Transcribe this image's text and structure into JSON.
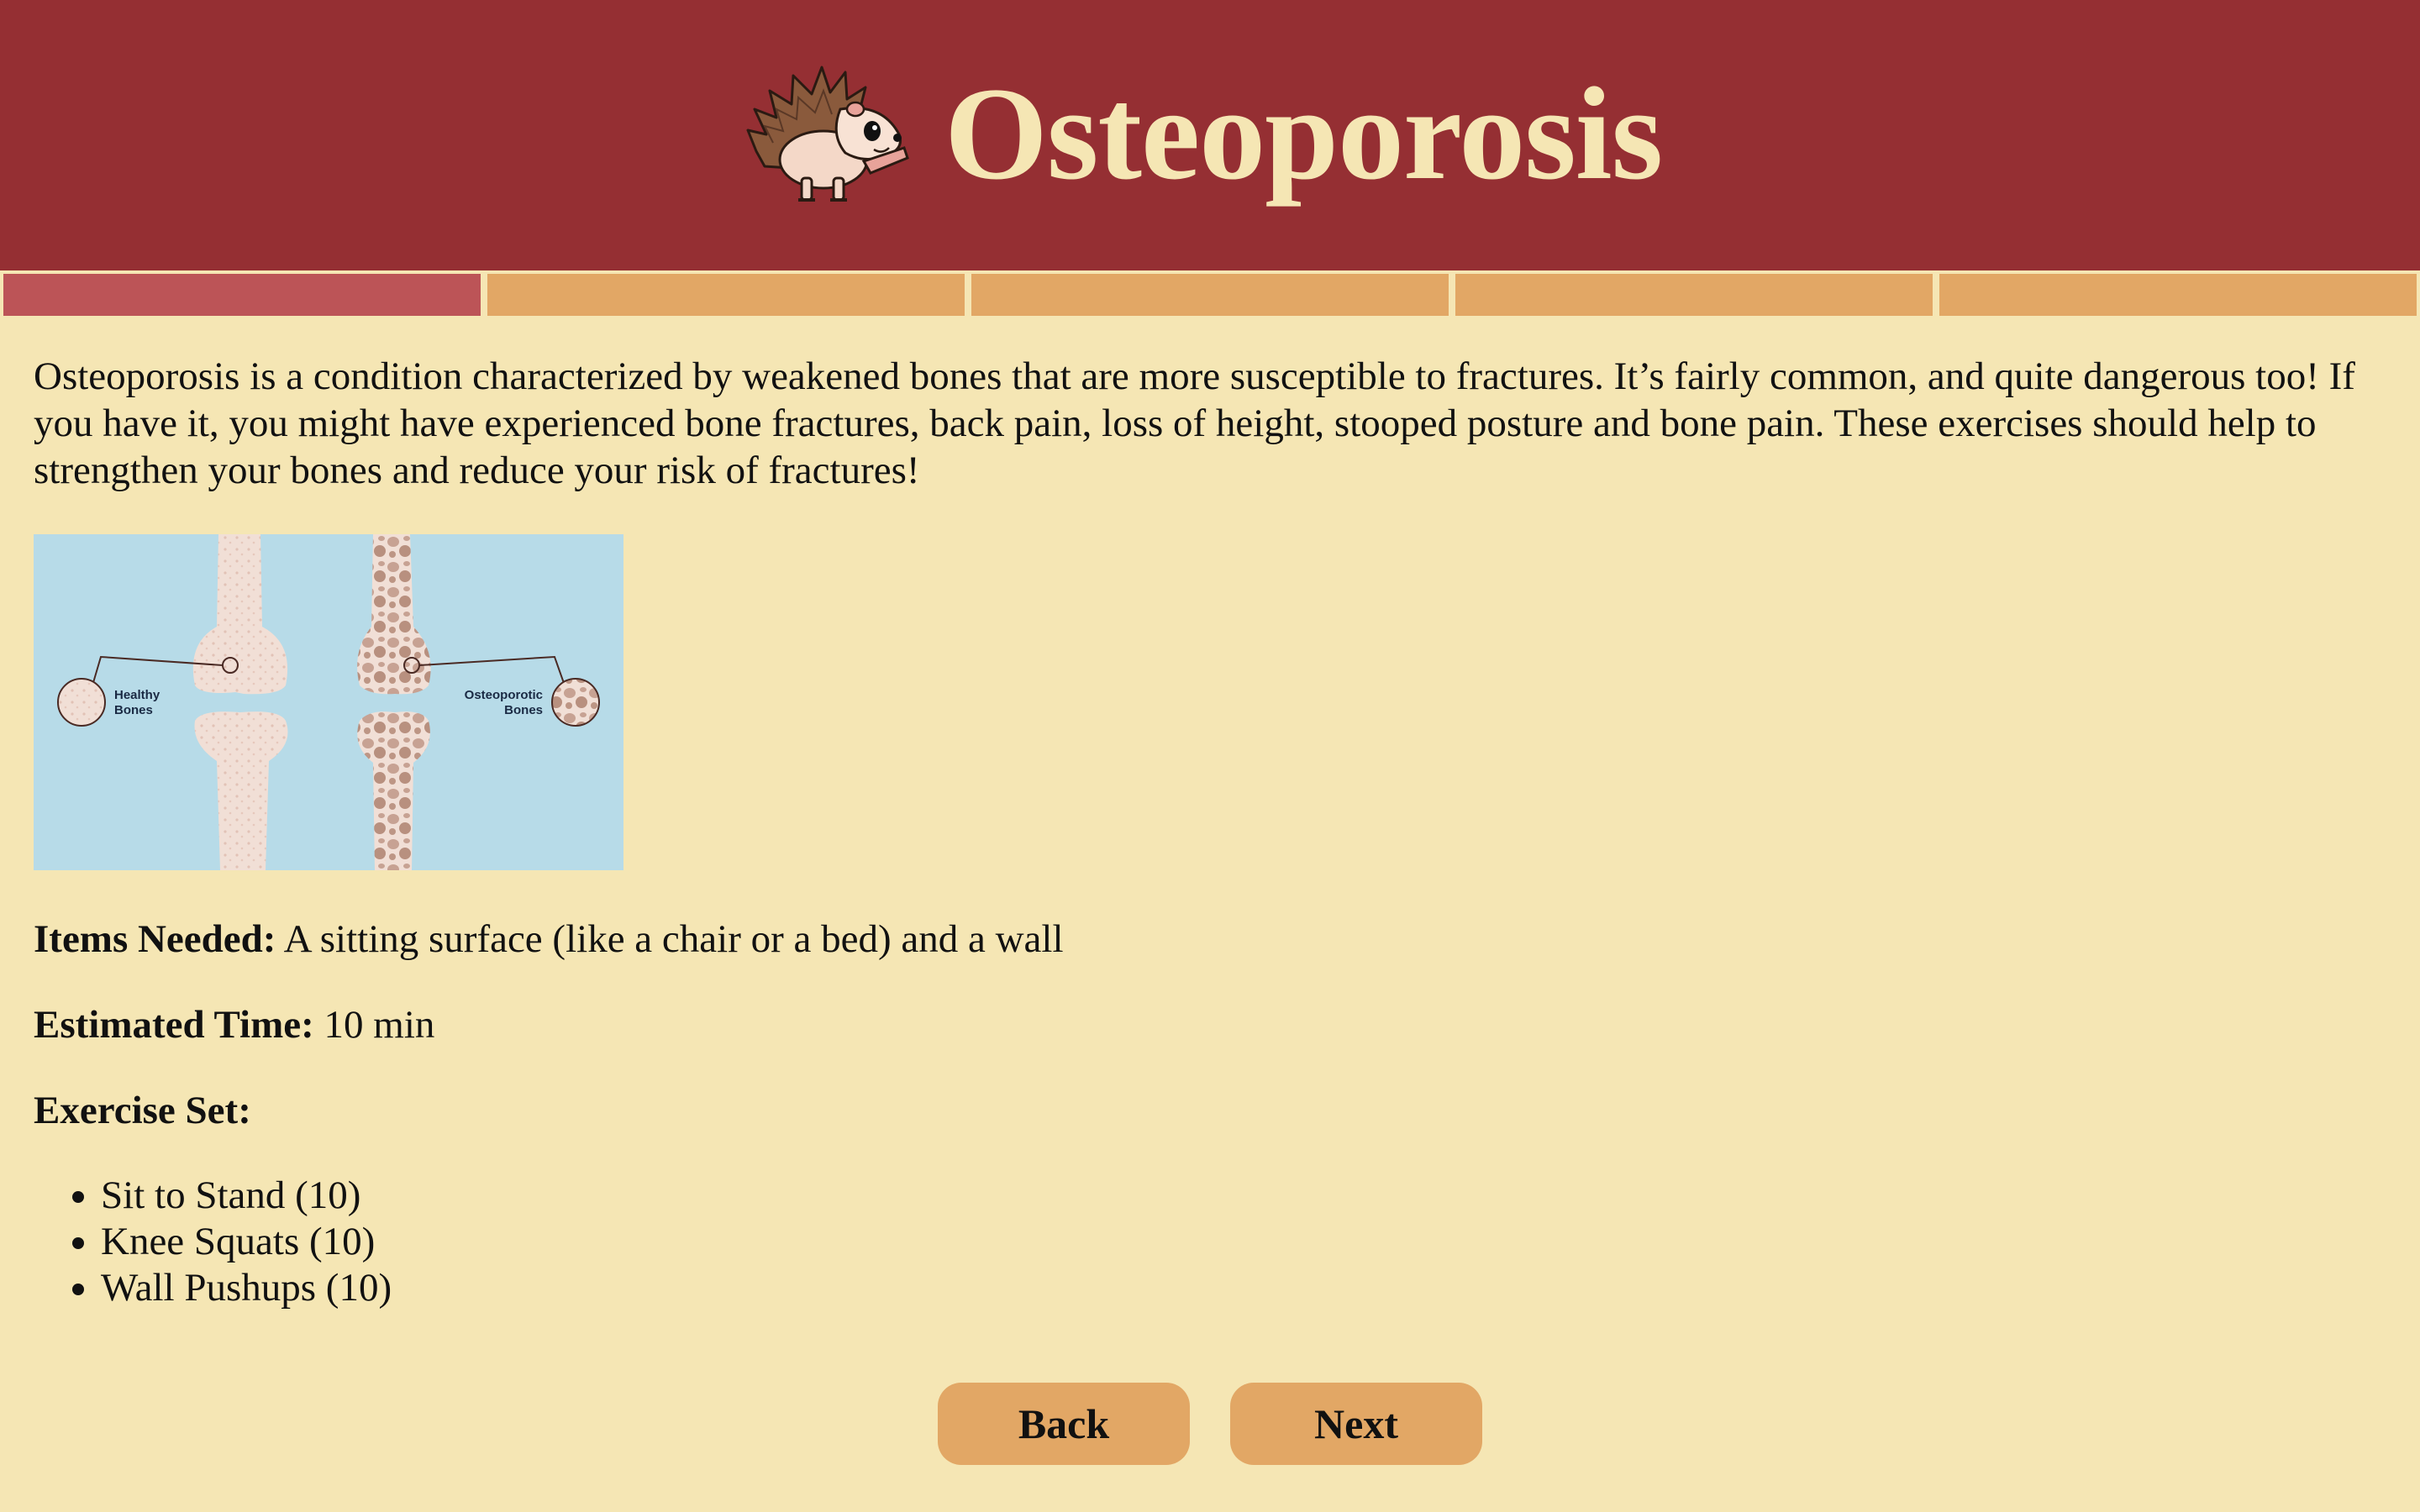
{
  "header": {
    "title": "Osteoporosis",
    "mascot_icon": "hedgehog-icon",
    "background_color": "#952f33",
    "title_color": "#f5e6b4"
  },
  "progress": {
    "total_steps": 5,
    "current_step": 1,
    "active_color": "#bc5457",
    "inactive_color": "#e2a765"
  },
  "intro_text": "Osteoporosis is a condition characterized by weakened bones that are more susceptible to fractures. It’s fairly common, and quite dangerous too! If you have it, you might have experienced bone fractures, back pain, loss of height, stooped posture and bone pain. These exercises should help to strengthen your bones and reduce your risk of fractures!",
  "illustration": {
    "left_label_line1": "Healthy",
    "left_label_line2": "Bones",
    "right_label_line1": "Osteoporotic",
    "right_label_line2": "Bones"
  },
  "items_needed": {
    "label": "Items Needed:",
    "value": "A sitting surface (like a chair or a bed) and a wall"
  },
  "estimated_time": {
    "label": "Estimated Time:",
    "value": "10 min"
  },
  "exercise_set": {
    "label": "Exercise Set:",
    "items": [
      "Sit to Stand (10)",
      "Knee Squats (10)",
      "Wall Pushups (10)"
    ]
  },
  "buttons": {
    "back_label": "Back",
    "next_label": "Next",
    "color": "#e2a765"
  },
  "page_background": "#f5e6b4"
}
